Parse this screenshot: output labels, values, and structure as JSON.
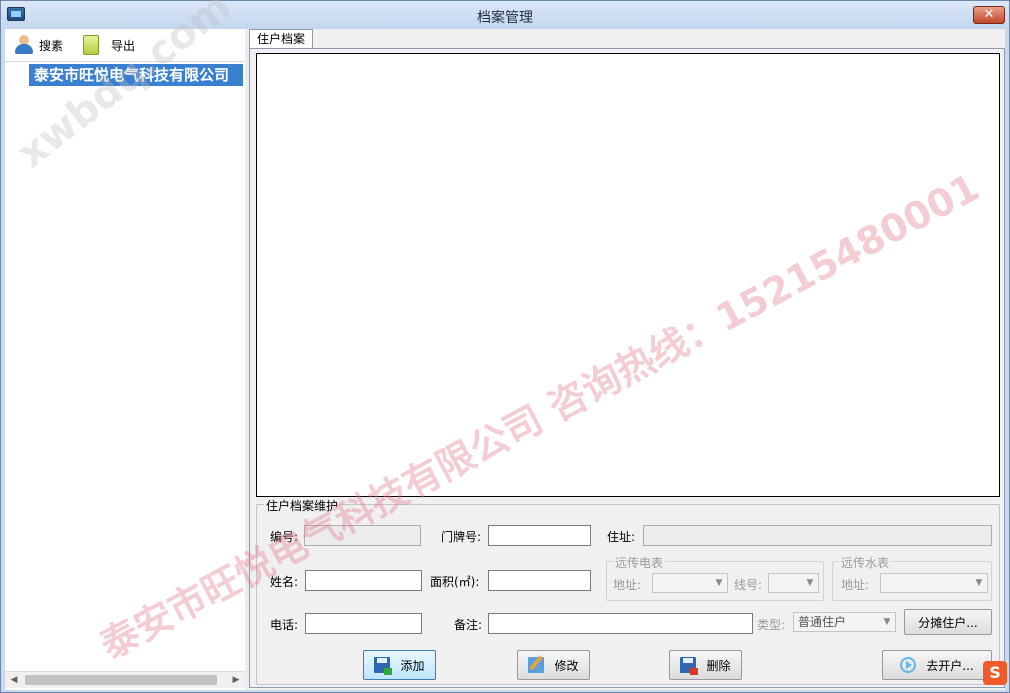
{
  "window": {
    "title": "档案管理",
    "close_label": "✕"
  },
  "toolbar": {
    "search_label": "搜素",
    "export_label": "导出"
  },
  "tree": {
    "selected_node": "泰安市旺悦电气科技有限公司"
  },
  "tabs": [
    {
      "label": "住户档案",
      "selected": true
    }
  ],
  "maintenance": {
    "legend": "住户档案维护",
    "fields": {
      "number_label": "编号:",
      "number_value": "",
      "door_label": "门牌号:",
      "door_value": "",
      "address_label": "住址:",
      "address_value": "",
      "name_label": "姓名:",
      "name_value": "",
      "area_label": "面积(㎡):",
      "area_value": "",
      "phone_label": "电话:",
      "phone_value": "",
      "remark_label": "备注:",
      "remark_value": "",
      "type_label": "类型:",
      "type_value": "普通住户"
    },
    "electric_meter": {
      "legend": "远传电表",
      "addr_label": "地址:",
      "line_label": "线号:"
    },
    "water_meter": {
      "legend": "远传水表",
      "addr_label": "地址:"
    },
    "buttons": {
      "share": "分摊住户...",
      "add": "添加",
      "modify": "修改",
      "delete": "删除",
      "open_account": "去开户..."
    }
  },
  "watermark": {
    "main_text": "泰安市旺悦电气科技有限公司  咨询热线：15215480001",
    "site_text": "xwbdq.com"
  },
  "brand_logo_letter": "S",
  "colors": {
    "selection": "#3a7fd0",
    "watermark": "#e2788c",
    "window_frame": "#c9d9ee"
  }
}
